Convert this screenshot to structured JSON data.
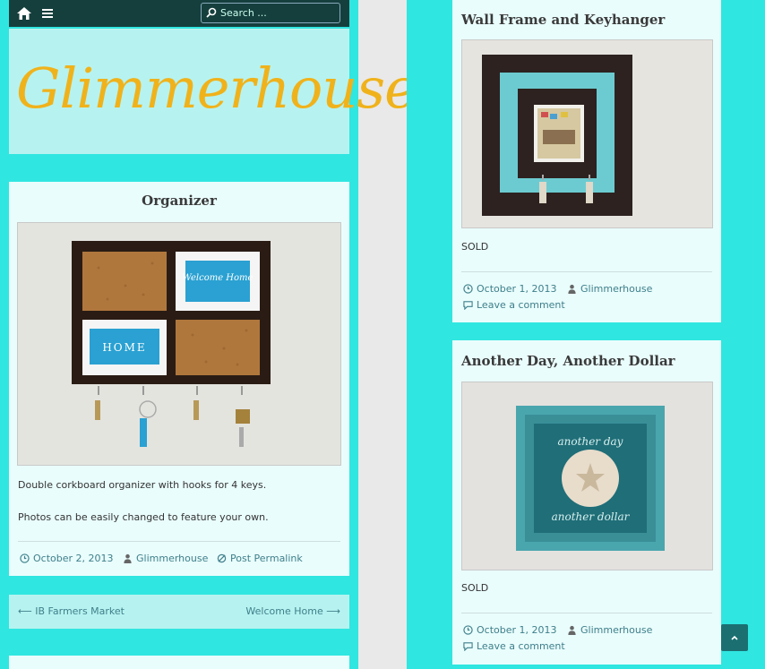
{
  "topbar": {
    "search_placeholder": "Search ...",
    "home_icon": "home-icon",
    "menu_icon": "menu-icon",
    "search_icon": "search-icon"
  },
  "site": {
    "title": "Glimmerhouse",
    "logo_color": "#f0b21b",
    "background_color": "#30e6e0",
    "card_color": "#e9fdfc",
    "link_color": "#3f7f8b"
  },
  "organizer": {
    "title": "Organizer",
    "photo_labels": [
      "Welcome Home",
      "HOME"
    ],
    "description": [
      "Double corkboard organizer with hooks for 4 keys.",
      "Photos can be easily changed to feature your own."
    ],
    "meta": {
      "date": "October 2, 2013",
      "author": "Glimmerhouse",
      "permalink": "Post Permalink"
    }
  },
  "post_nav": {
    "previous": "⟵ IB Farmers Market",
    "next": "Welcome Home ⟶"
  },
  "frame_post": {
    "title": "Wall Frame and Keyhanger",
    "status": "SOLD",
    "meta": {
      "date": "October 1, 2013",
      "author": "Glimmerhouse",
      "comment": "Leave a comment"
    }
  },
  "dollar_post": {
    "title": "Another Day, Another Dollar",
    "photo_labels": [
      "another day",
      "another dollar"
    ],
    "status": "SOLD",
    "meta": {
      "date": "October 1, 2013",
      "author": "Glimmerhouse",
      "comment": "Leave a comment"
    }
  },
  "scroll_top_icon": "chevron-up-icon"
}
